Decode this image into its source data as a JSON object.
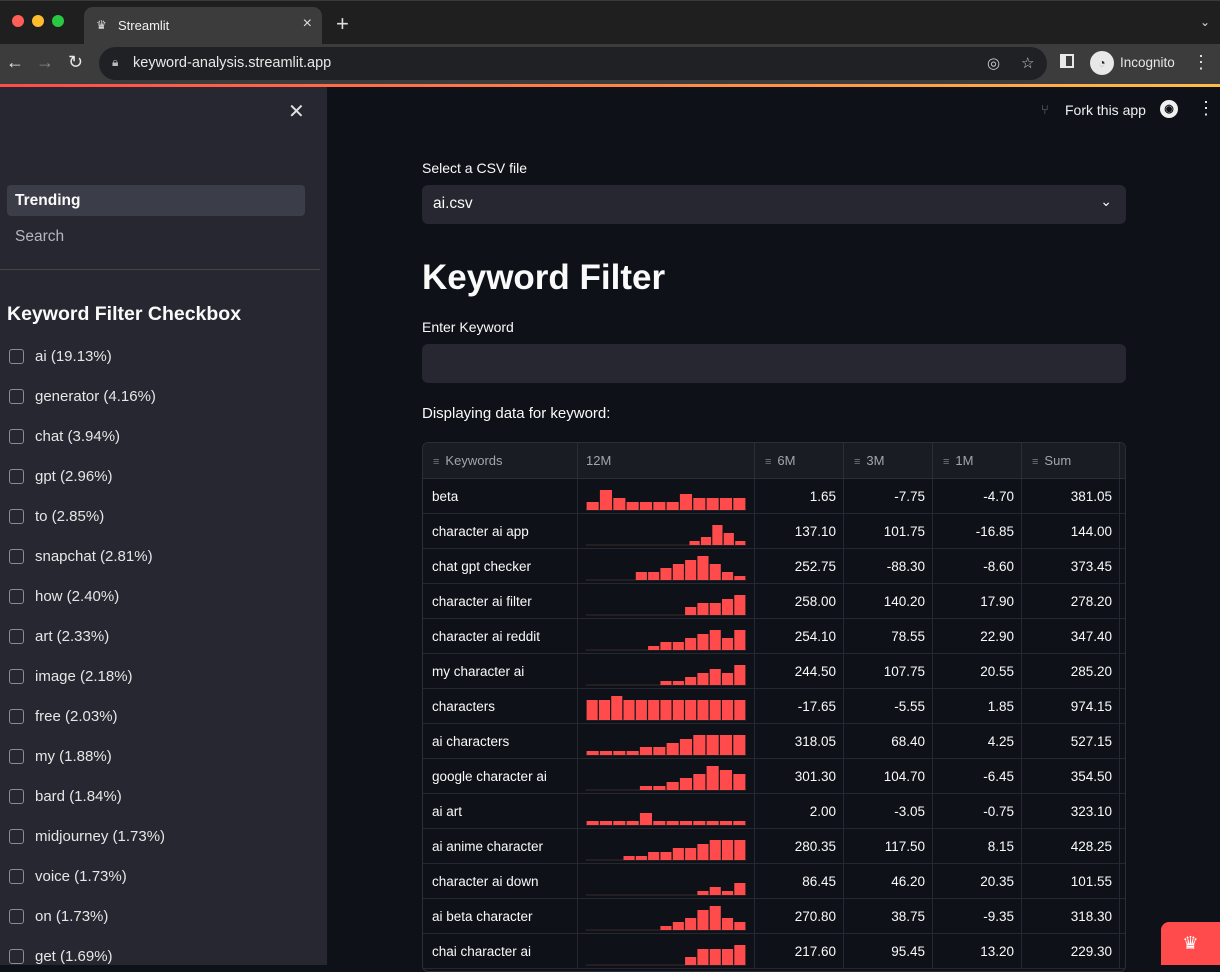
{
  "browser": {
    "tab_title": "Streamlit",
    "url": "keyword-analysis.streamlit.app",
    "profile_label": "Incognito"
  },
  "sidebar": {
    "nav": [
      {
        "label": "Trending",
        "active": true
      },
      {
        "label": "Search",
        "active": false
      }
    ],
    "heading": "Keyword Filter Checkbox",
    "checkboxes": [
      "ai (19.13%)",
      "generator (4.16%)",
      "chat (3.94%)",
      "gpt (2.96%)",
      "to (2.85%)",
      "snapchat (2.81%)",
      "how (2.40%)",
      "art (2.33%)",
      "image (2.18%)",
      "free (2.03%)",
      "my (1.88%)",
      "bard (1.84%)",
      "midjourney (1.73%)",
      "voice (1.73%)",
      "on (1.73%)",
      "get (1.69%)"
    ]
  },
  "main": {
    "fork_label": "Fork this app",
    "select_label": "Select a CSV file",
    "select_value": "ai.csv",
    "title": "Keyword Filter",
    "input_label": "Enter Keyword",
    "input_value": "",
    "displaying": "Displaying data for keyword:",
    "columns": [
      "Keywords",
      "12M",
      "6M",
      "3M",
      "1M",
      "Sum"
    ],
    "rows": [
      {
        "kw": "beta",
        "spark": [
          2,
          5,
          3,
          2,
          2,
          2,
          2,
          4,
          3,
          3,
          3,
          3
        ],
        "m6": "1.65",
        "m3": "-7.75",
        "m1": "-4.70",
        "sum": "381.05"
      },
      {
        "kw": "character ai app",
        "spark": [
          0,
          0,
          0,
          0,
          0,
          0,
          0,
          0,
          0,
          1,
          2,
          5,
          3,
          1
        ],
        "m6": "137.10",
        "m3": "101.75",
        "m1": "-16.85",
        "sum": "144.00"
      },
      {
        "kw": "chat gpt checker",
        "spark": [
          0,
          0,
          0,
          0,
          2,
          2,
          3,
          4,
          5,
          6,
          4,
          2,
          1
        ],
        "m6": "252.75",
        "m3": "-88.30",
        "m1": "-8.60",
        "sum": "373.45"
      },
      {
        "kw": "character ai filter",
        "spark": [
          0,
          0,
          0,
          0,
          0,
          0,
          0,
          0,
          2,
          3,
          3,
          4,
          5
        ],
        "m6": "258.00",
        "m3": "140.20",
        "m1": "17.90",
        "sum": "278.20"
      },
      {
        "kw": "character ai reddit",
        "spark": [
          0,
          0,
          0,
          0,
          0,
          1,
          2,
          2,
          3,
          4,
          5,
          3,
          5
        ],
        "m6": "254.10",
        "m3": "78.55",
        "m1": "22.90",
        "sum": "347.40"
      },
      {
        "kw": "my character ai",
        "spark": [
          0,
          0,
          0,
          0,
          0,
          0,
          1,
          1,
          2,
          3,
          4,
          3,
          5
        ],
        "m6": "244.50",
        "m3": "107.75",
        "m1": "20.55",
        "sum": "285.20"
      },
      {
        "kw": "characters",
        "spark": [
          5,
          5,
          6,
          5,
          5,
          5,
          5,
          5,
          5,
          5,
          5,
          5,
          5
        ],
        "m6": "-17.65",
        "m3": "-5.55",
        "m1": "1.85",
        "sum": "974.15"
      },
      {
        "kw": "ai characters",
        "spark": [
          1,
          1,
          1,
          1,
          2,
          2,
          3,
          4,
          5,
          5,
          5,
          5
        ],
        "m6": "318.05",
        "m3": "68.40",
        "m1": "4.25",
        "sum": "527.15"
      },
      {
        "kw": "google character ai",
        "spark": [
          0,
          0,
          0,
          0,
          1,
          1,
          2,
          3,
          4,
          6,
          5,
          4
        ],
        "m6": "301.30",
        "m3": "104.70",
        "m1": "-6.45",
        "sum": "354.50"
      },
      {
        "kw": "ai art",
        "spark": [
          1,
          1,
          1,
          1,
          3,
          1,
          1,
          1,
          1,
          1,
          1,
          1
        ],
        "m6": "2.00",
        "m3": "-3.05",
        "m1": "-0.75",
        "sum": "323.10"
      },
      {
        "kw": "ai anime character",
        "spark": [
          0,
          0,
          0,
          1,
          1,
          2,
          2,
          3,
          3,
          4,
          5,
          5,
          5
        ],
        "m6": "280.35",
        "m3": "117.50",
        "m1": "8.15",
        "sum": "428.25"
      },
      {
        "kw": "character ai down",
        "spark": [
          0,
          0,
          0,
          0,
          0,
          0,
          0,
          0,
          0,
          1,
          2,
          1,
          3
        ],
        "m6": "86.45",
        "m3": "46.20",
        "m1": "20.35",
        "sum": "101.55"
      },
      {
        "kw": "ai beta character",
        "spark": [
          0,
          0,
          0,
          0,
          0,
          0,
          1,
          2,
          3,
          5,
          6,
          3,
          2
        ],
        "m6": "270.80",
        "m3": "38.75",
        "m1": "-9.35",
        "sum": "318.30"
      },
      {
        "kw": "chai character ai",
        "spark": [
          0,
          0,
          0,
          0,
          0,
          0,
          0,
          0,
          2,
          4,
          4,
          4,
          5
        ],
        "m6": "217.60",
        "m3": "95.45",
        "m1": "13.20",
        "sum": "229.30"
      }
    ]
  },
  "colors": {
    "accent": "#ff4b4b",
    "background": "#0e1117",
    "sidebar": "#262730"
  }
}
